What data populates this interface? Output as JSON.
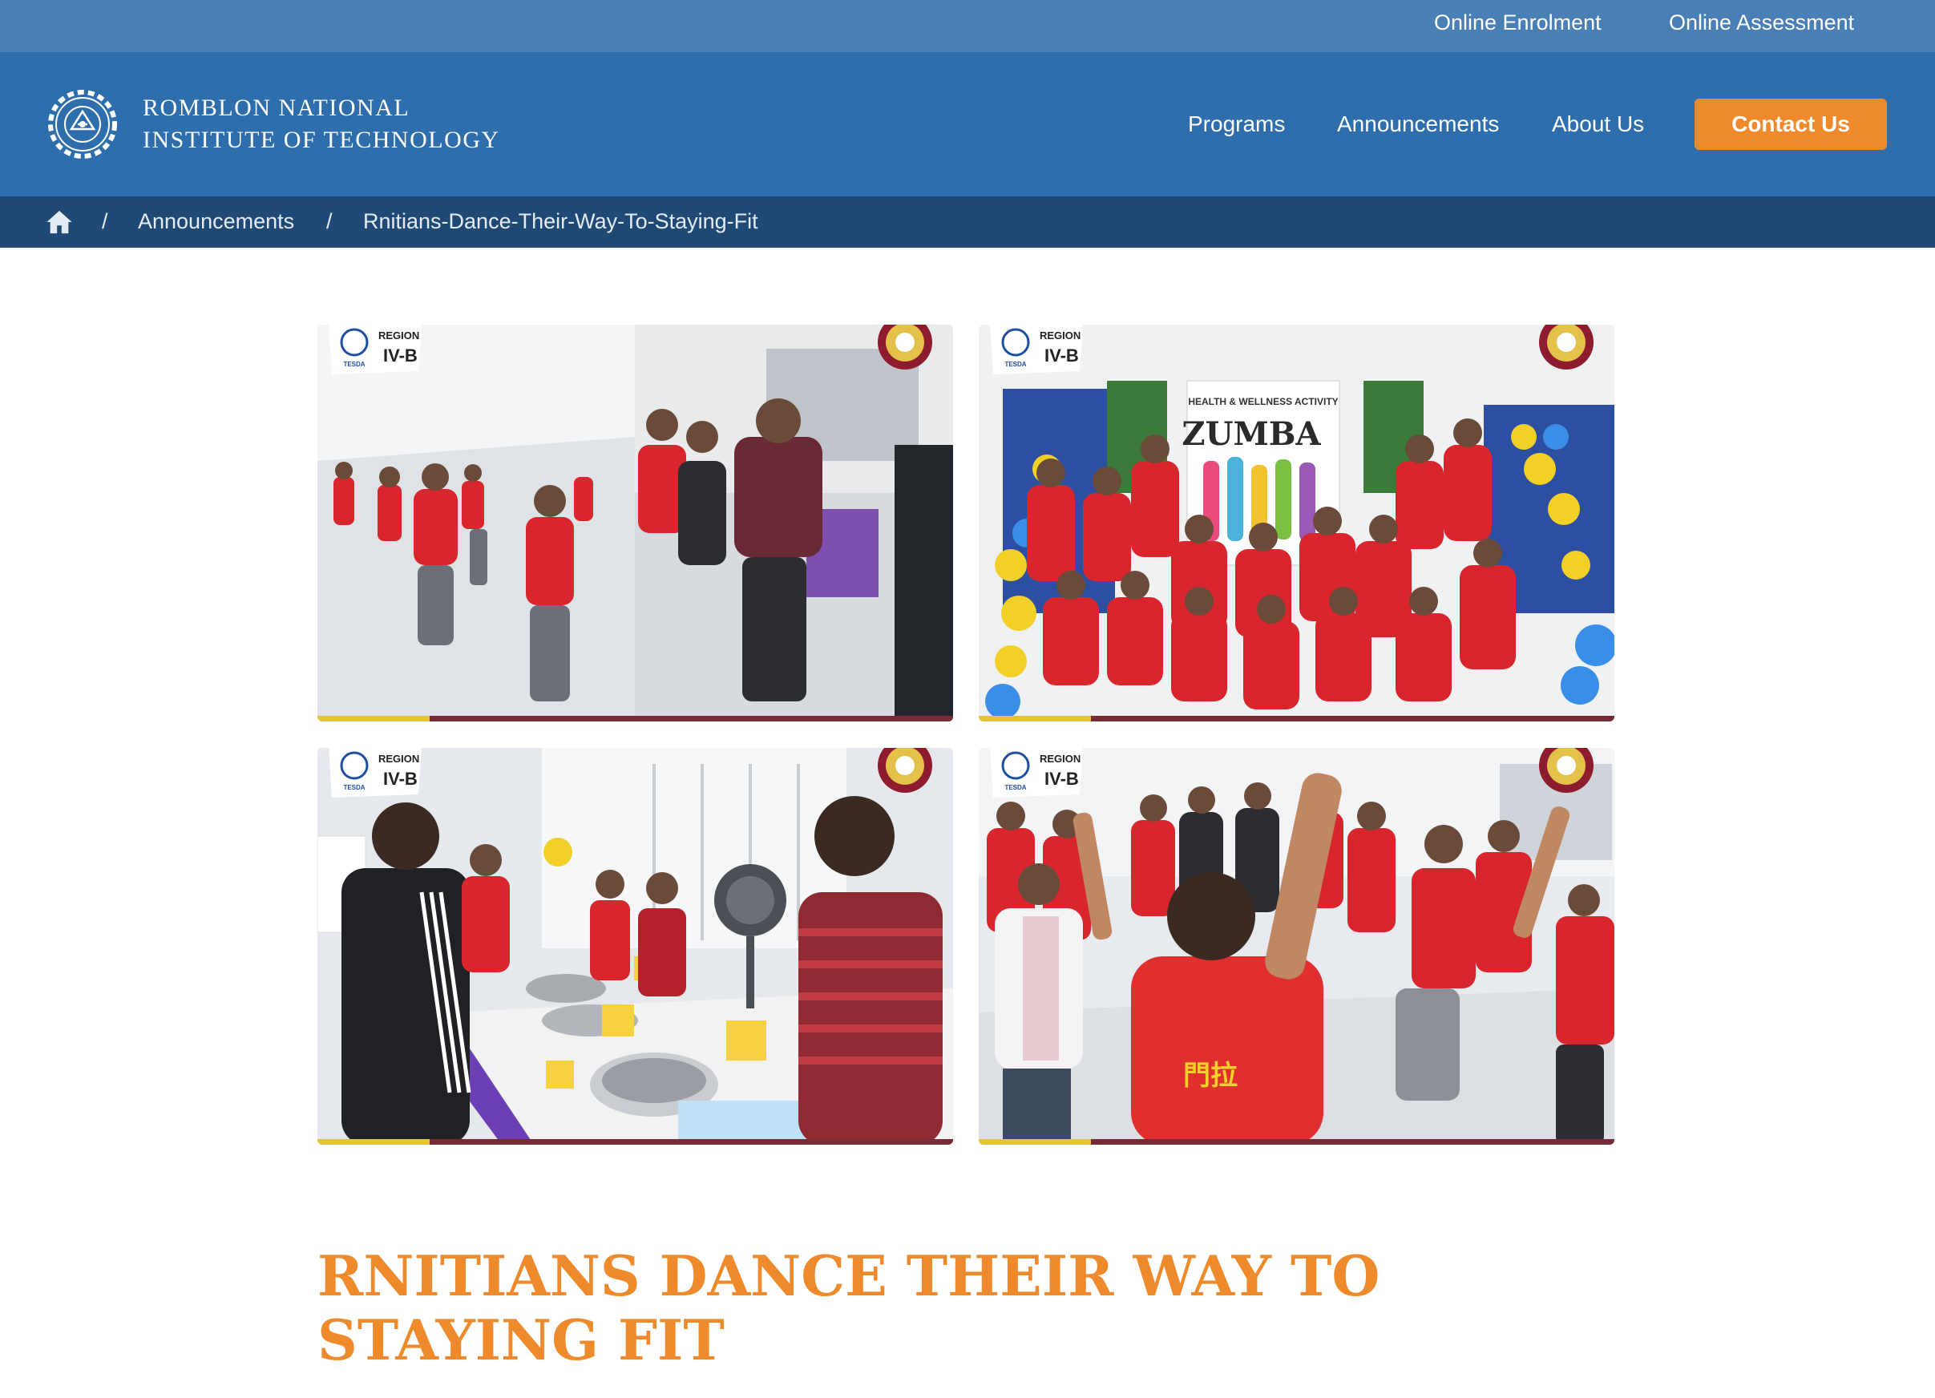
{
  "topbar": {
    "online_enrolment": "Online Enrolment",
    "online_assessment": "Online Assessment"
  },
  "header": {
    "brand_line1": "ROMBLON NATIONAL",
    "brand_line2": "INSTITUTE OF TECHNOLOGY",
    "nav": {
      "programs": "Programs",
      "announcements": "Announcements",
      "about": "About Us"
    },
    "contact_label": "Contact Us"
  },
  "breadcrumb": {
    "separator": "/",
    "items": [
      "Announcements",
      "Rnitians-Dance-Their-Way-To-Staying-Fit"
    ]
  },
  "gallery": {
    "badge_region": "REGION",
    "badge_code": "IV-B",
    "badge_org": "TESDA",
    "banner_title": "HEALTH & WELLNESS ACTIVITY",
    "banner_word": "ZUMBA"
  },
  "article": {
    "title": "RNITIANS DANCE THEIR WAY TO STAYING FIT"
  },
  "colors": {
    "topbar": "#4a7fb5",
    "header": "#2f6ead",
    "breadcrumb": "#204a75",
    "accent": "#ef8a2c"
  },
  "icons": {
    "home": "home-icon",
    "logo": "institution-gear-logo"
  }
}
